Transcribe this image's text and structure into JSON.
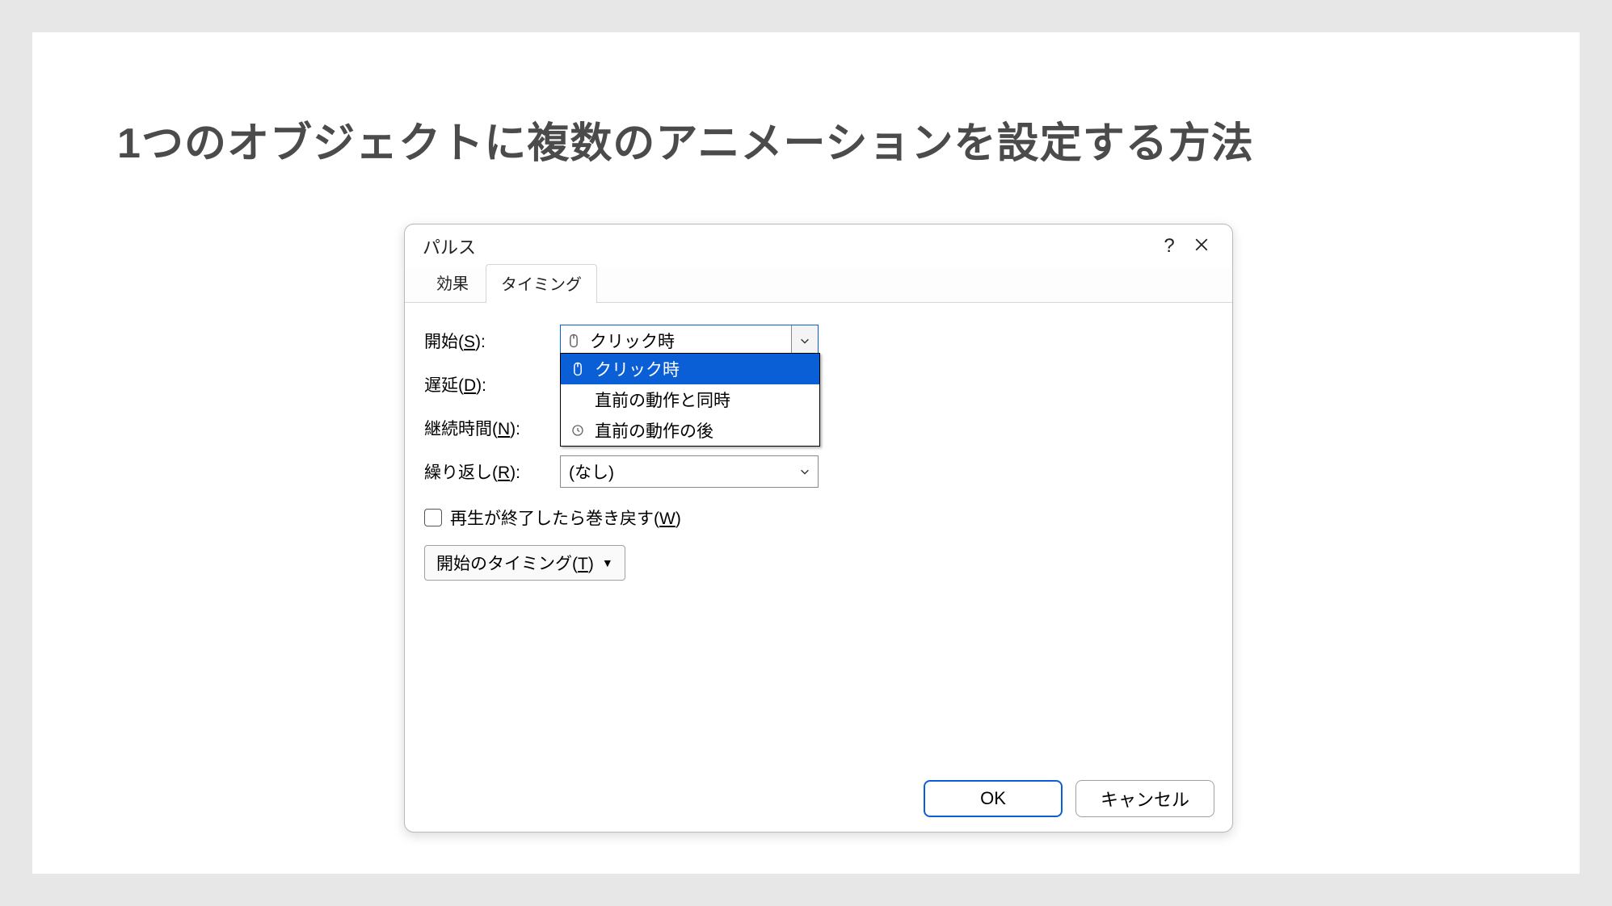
{
  "page_title": "1つのオブジェクトに複数のアニメーションを設定する方法",
  "dialog": {
    "title": "パルス",
    "help_tooltip": "?",
    "tabs": {
      "effect": "効果",
      "timing": "タイミング"
    },
    "rows": {
      "start": {
        "label": "開始(",
        "accel": "S",
        "after": "):"
      },
      "delay": {
        "label": "遅延(",
        "accel": "D",
        "after": "):"
      },
      "duration": {
        "label": "継続時間(",
        "accel": "N",
        "after": "):"
      },
      "repeat": {
        "label": "繰り返し(",
        "accel": "R",
        "after": "):"
      }
    },
    "start_combo_value": "クリック時",
    "dropdown_options": {
      "click": "クリック時",
      "with_prev": "直前の動作と同時",
      "after_prev": "直前の動作の後"
    },
    "repeat_value": "(なし)",
    "rewind": {
      "pre": "再生が終了したら巻き戻す(",
      "accel": "W",
      "after": ")"
    },
    "trigger_btn": {
      "pre": "開始のタイミング(",
      "accel": "T",
      "after": ")"
    },
    "buttons": {
      "ok": "OK",
      "cancel": "キャンセル"
    }
  }
}
